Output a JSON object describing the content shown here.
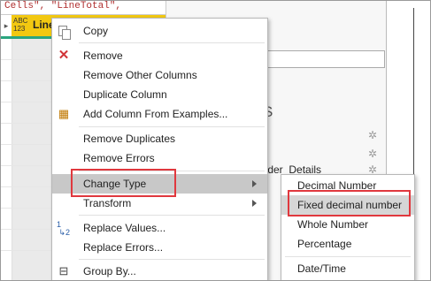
{
  "formula_bar": {
    "text": "Cells\", \"LineTotal\","
  },
  "column": {
    "type_glyph": "ABC\n123",
    "name": "Line"
  },
  "right_pane": {
    "section_letter": "S",
    "partial_label": "Order_Details"
  },
  "context_menu": {
    "items": [
      {
        "label": "Copy",
        "icon": "copy-icon"
      },
      {
        "label": "Remove",
        "icon": "remove-icon"
      },
      {
        "label": "Remove Other Columns"
      },
      {
        "label": "Duplicate Column"
      },
      {
        "label": "Add Column From Examples...",
        "icon": "add-column-from-examples-icon"
      },
      {
        "label": "Remove Duplicates"
      },
      {
        "label": "Remove Errors"
      },
      {
        "label": "Change Type",
        "has_submenu": true,
        "state": "hover"
      },
      {
        "label": "Transform",
        "has_submenu": true
      },
      {
        "label": "Replace Values...",
        "icon": "replace-values-icon"
      },
      {
        "label": "Replace Errors..."
      },
      {
        "label": "Group By...",
        "icon": "group-by-icon"
      }
    ]
  },
  "submenu": {
    "items": [
      {
        "label": "Decimal Number"
      },
      {
        "label": "Fixed decimal number",
        "state": "hover"
      },
      {
        "label": "Whole Number"
      },
      {
        "label": "Percentage"
      },
      {
        "label": "Date/Time"
      }
    ]
  },
  "colors": {
    "highlight": "#e0383e",
    "column_header": "#f2c811",
    "quality_bar": "#2aa57f",
    "menu_hover": "#c8c8c8"
  }
}
